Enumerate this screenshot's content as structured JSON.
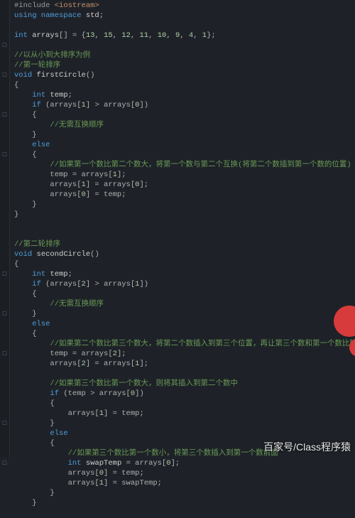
{
  "watermark": "百家号/Class程序猿",
  "gutter": [
    "",
    "",
    "",
    "",
    "□",
    "",
    "",
    "□",
    "",
    "",
    "",
    "□",
    "",
    "",
    "",
    "□",
    "",
    "",
    "",
    "",
    "",
    "",
    "",
    "",
    "",
    "",
    "",
    "□",
    "",
    "",
    "",
    "□",
    "",
    "",
    "",
    "□",
    "",
    "",
    "",
    "",
    "",
    "",
    "□",
    "",
    "",
    "",
    "□",
    "",
    "",
    "",
    "",
    ""
  ],
  "lines": [
    [
      [
        "k-pre",
        "#include "
      ],
      [
        "k-str",
        "<iostream>"
      ]
    ],
    [
      [
        "k-blue",
        "using namespace "
      ],
      [
        "k-var",
        "std"
      ],
      [
        "k-punc",
        ";"
      ]
    ],
    [],
    [
      [
        "k-blue",
        "int "
      ],
      [
        "k-var",
        "arrays"
      ],
      [
        "k-punc",
        "[] = {"
      ],
      [
        "k-num",
        "13"
      ],
      [
        "k-punc",
        ", "
      ],
      [
        "k-num",
        "15"
      ],
      [
        "k-punc",
        ", "
      ],
      [
        "k-num",
        "12"
      ],
      [
        "k-punc",
        ", "
      ],
      [
        "k-num",
        "11"
      ],
      [
        "k-punc",
        ", "
      ],
      [
        "k-num",
        "10"
      ],
      [
        "k-punc",
        ", "
      ],
      [
        "k-num",
        "9"
      ],
      [
        "k-punc",
        ", "
      ],
      [
        "k-num",
        "4"
      ],
      [
        "k-punc",
        ", "
      ],
      [
        "k-num",
        "1"
      ],
      [
        "k-punc",
        "};"
      ]
    ],
    [],
    [
      [
        "k-green",
        "//以从小到大排序为例"
      ]
    ],
    [
      [
        "k-green",
        "//第一轮排序"
      ]
    ],
    [
      [
        "k-blue",
        "void "
      ],
      [
        "k-fn",
        "firstCircle"
      ],
      [
        "k-punc",
        "()"
      ]
    ],
    [
      [
        "k-punc",
        "{"
      ]
    ],
    [
      [
        "k-punc",
        "    "
      ],
      [
        "k-blue",
        "int "
      ],
      [
        "k-var",
        "temp"
      ],
      [
        "k-punc",
        ";"
      ]
    ],
    [
      [
        "k-punc",
        "    "
      ],
      [
        "k-blue",
        "if "
      ],
      [
        "k-punc",
        "(arrays["
      ],
      [
        "k-num",
        "1"
      ],
      [
        "k-punc",
        "] > arrays["
      ],
      [
        "k-num",
        "0"
      ],
      [
        "k-punc",
        "])"
      ]
    ],
    [
      [
        "k-punc",
        "    {"
      ]
    ],
    [
      [
        "k-punc",
        "        "
      ],
      [
        "k-green",
        "//无需互换顺序"
      ]
    ],
    [
      [
        "k-punc",
        "    }"
      ]
    ],
    [
      [
        "k-punc",
        "    "
      ],
      [
        "k-blue",
        "else"
      ]
    ],
    [
      [
        "k-punc",
        "    {"
      ]
    ],
    [
      [
        "k-punc",
        "        "
      ],
      [
        "k-green",
        "//如果第一个数比第二个数大，将第一个数与第二个互换(将第二个数插到第一个数的位置)"
      ]
    ],
    [
      [
        "k-punc",
        "        temp = arrays["
      ],
      [
        "k-num",
        "1"
      ],
      [
        "k-punc",
        "];"
      ]
    ],
    [
      [
        "k-punc",
        "        arrays["
      ],
      [
        "k-num",
        "1"
      ],
      [
        "k-punc",
        "] = arrays["
      ],
      [
        "k-num",
        "0"
      ],
      [
        "k-punc",
        "];"
      ]
    ],
    [
      [
        "k-punc",
        "        arrays["
      ],
      [
        "k-num",
        "0"
      ],
      [
        "k-punc",
        "] = temp;"
      ]
    ],
    [
      [
        "k-punc",
        "    }"
      ]
    ],
    [
      [
        "k-punc",
        "}"
      ]
    ],
    [],
    [],
    [
      [
        "k-green",
        "//第二轮排序"
      ]
    ],
    [
      [
        "k-blue",
        "void "
      ],
      [
        "k-fn",
        "secondCircle"
      ],
      [
        "k-punc",
        "()"
      ]
    ],
    [
      [
        "k-punc",
        "{"
      ]
    ],
    [
      [
        "k-punc",
        "    "
      ],
      [
        "k-blue",
        "int "
      ],
      [
        "k-var",
        "temp"
      ],
      [
        "k-punc",
        ";"
      ]
    ],
    [
      [
        "k-punc",
        "    "
      ],
      [
        "k-blue",
        "if "
      ],
      [
        "k-punc",
        "(arrays["
      ],
      [
        "k-num",
        "2"
      ],
      [
        "k-punc",
        "] > arrays["
      ],
      [
        "k-num",
        "1"
      ],
      [
        "k-punc",
        "])"
      ]
    ],
    [
      [
        "k-punc",
        "    {"
      ]
    ],
    [
      [
        "k-punc",
        "        "
      ],
      [
        "k-green",
        "//无需互换顺序"
      ]
    ],
    [
      [
        "k-punc",
        "    }"
      ]
    ],
    [
      [
        "k-punc",
        "    "
      ],
      [
        "k-blue",
        "else"
      ]
    ],
    [
      [
        "k-punc",
        "    {"
      ]
    ],
    [
      [
        "k-punc",
        "        "
      ],
      [
        "k-green",
        "//如果第二个数比第三个数大，将第二个数插入到第三个位置，再让第三个数和第一个数比较"
      ]
    ],
    [
      [
        "k-punc",
        "        temp = arrays["
      ],
      [
        "k-num",
        "2"
      ],
      [
        "k-punc",
        "];"
      ]
    ],
    [
      [
        "k-punc",
        "        arrays["
      ],
      [
        "k-num",
        "2"
      ],
      [
        "k-punc",
        "] = arrays["
      ],
      [
        "k-num",
        "1"
      ],
      [
        "k-punc",
        "];"
      ]
    ],
    [],
    [
      [
        "k-punc",
        "        "
      ],
      [
        "k-green",
        "//如果第三个数比第一个数大，则将其插入到第二个数中"
      ]
    ],
    [
      [
        "k-punc",
        "        "
      ],
      [
        "k-blue",
        "if "
      ],
      [
        "k-punc",
        "(temp > arrays["
      ],
      [
        "k-num",
        "0"
      ],
      [
        "k-punc",
        "])"
      ]
    ],
    [
      [
        "k-punc",
        "        {"
      ]
    ],
    [
      [
        "k-punc",
        "            arrays["
      ],
      [
        "k-num",
        "1"
      ],
      [
        "k-punc",
        "] = temp;"
      ]
    ],
    [
      [
        "k-punc",
        "        }"
      ]
    ],
    [
      [
        "k-punc",
        "        "
      ],
      [
        "k-blue",
        "else"
      ]
    ],
    [
      [
        "k-punc",
        "        {"
      ]
    ],
    [
      [
        "k-punc",
        "            "
      ],
      [
        "k-green",
        "//如果第三个数比第一个数小，将第三个数插入到第一个数前面"
      ]
    ],
    [
      [
        "k-punc",
        "            "
      ],
      [
        "k-blue",
        "int "
      ],
      [
        "k-var",
        "swapTemp"
      ],
      [
        "k-punc",
        " = arrays["
      ],
      [
        "k-num",
        "0"
      ],
      [
        "k-punc",
        "];"
      ]
    ],
    [
      [
        "k-punc",
        "            arrays["
      ],
      [
        "k-num",
        "0"
      ],
      [
        "k-punc",
        "] = temp;"
      ]
    ],
    [
      [
        "k-punc",
        "            arrays["
      ],
      [
        "k-num",
        "1"
      ],
      [
        "k-punc",
        "] = swapTemp;"
      ]
    ],
    [
      [
        "k-punc",
        "        }"
      ]
    ],
    [
      [
        "k-punc",
        "    }"
      ]
    ]
  ]
}
